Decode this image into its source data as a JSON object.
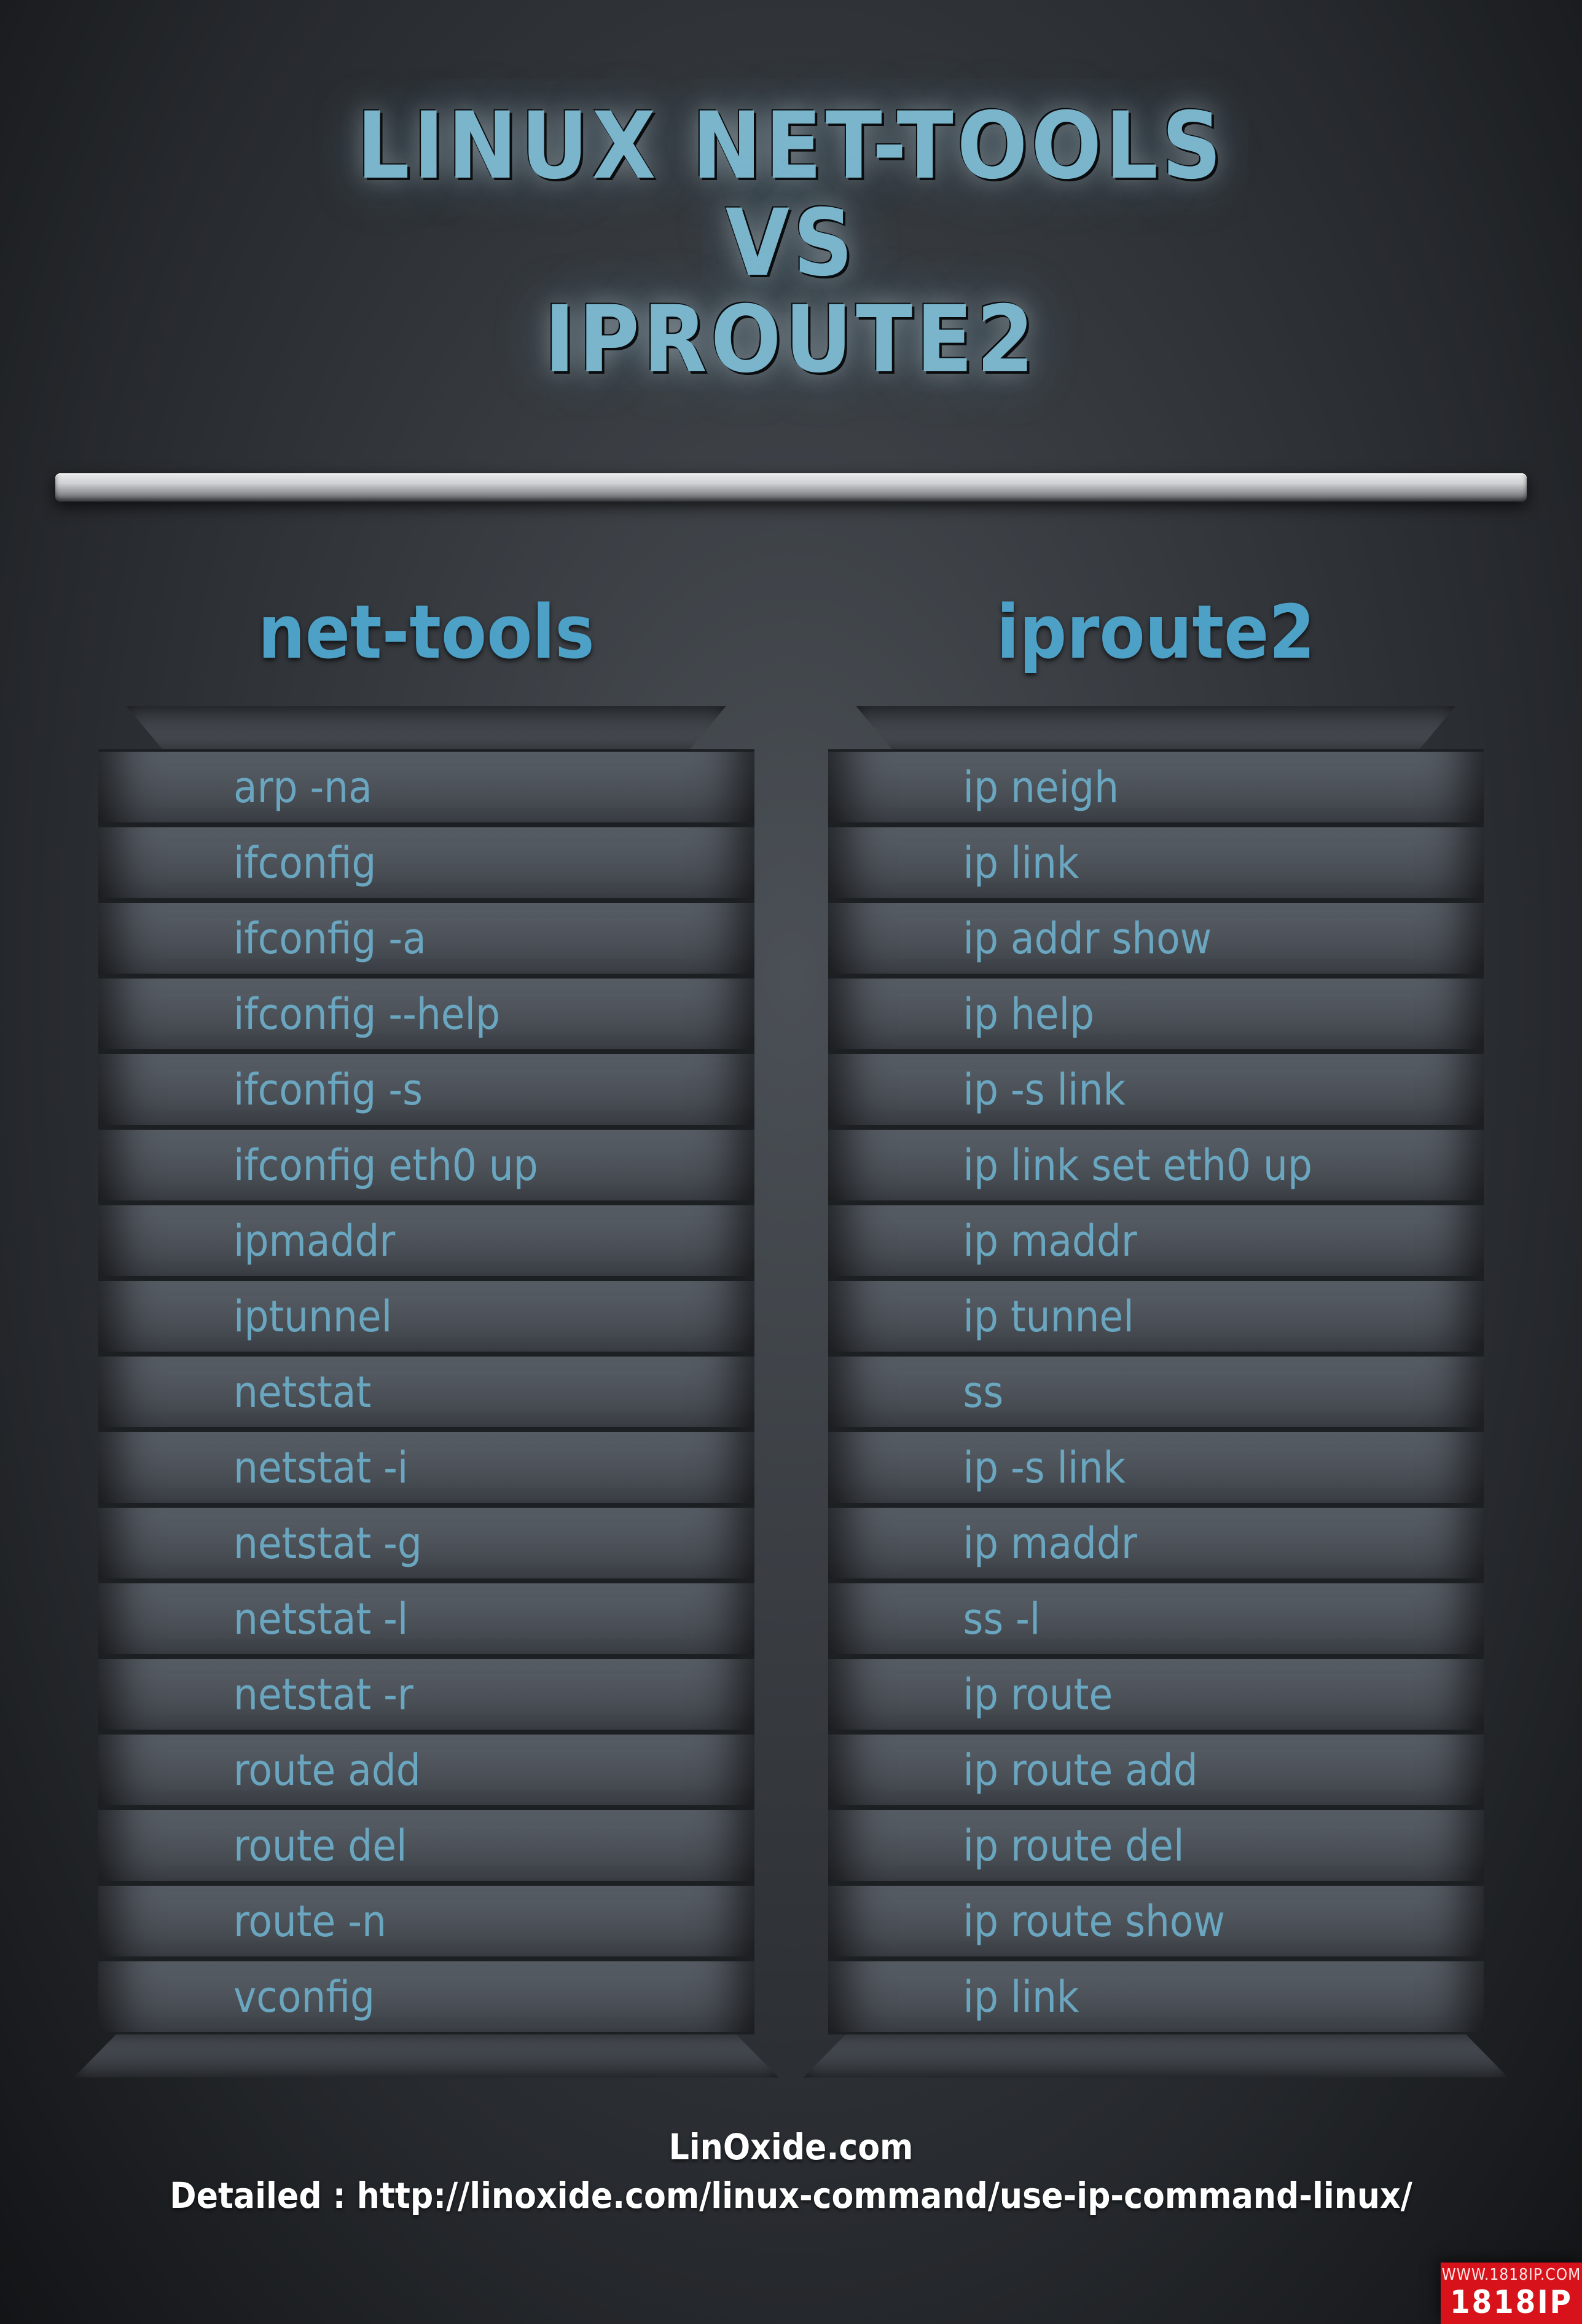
{
  "title": {
    "line1": "LINUX NET-TOOLS",
    "line2": "VS",
    "line3": "IPROUTE2"
  },
  "columns": {
    "left": {
      "heading": "net-tools"
    },
    "right": {
      "heading": "iproute2"
    }
  },
  "rows": [
    {
      "left": "arp -na",
      "right": "ip neigh"
    },
    {
      "left": "ifconfig",
      "right": "ip link"
    },
    {
      "left": "ifconfig -a",
      "right": "ip addr show"
    },
    {
      "left": "ifconfig --help",
      "right": "ip help"
    },
    {
      "left": "ifconfig -s",
      "right": "ip -s link"
    },
    {
      "left": "ifconfig eth0 up",
      "right": "ip link set eth0 up"
    },
    {
      "left": "ipmaddr",
      "right": "ip maddr"
    },
    {
      "left": "iptunnel",
      "right": "ip tunnel"
    },
    {
      "left": "netstat",
      "right": "ss"
    },
    {
      "left": "netstat -i",
      "right": "ip -s link"
    },
    {
      "left": "netstat  -g",
      "right": "ip maddr"
    },
    {
      "left": "netstat -l",
      "right": "ss -l"
    },
    {
      "left": "netstat -r",
      "right": "ip route"
    },
    {
      "left": "route add",
      "right": "ip route add"
    },
    {
      "left": "route del",
      "right": "ip route del"
    },
    {
      "left": "route -n",
      "right": "ip route show"
    },
    {
      "left": "vconfig",
      "right": "ip link"
    }
  ],
  "footer": {
    "site": "LinOxide.com",
    "detail": "Detailed : http://linoxide.com/linux-command/use-ip-command-linux/"
  },
  "badge": {
    "small": "WWW.1818IP.COM",
    "large": "1818IP"
  }
}
